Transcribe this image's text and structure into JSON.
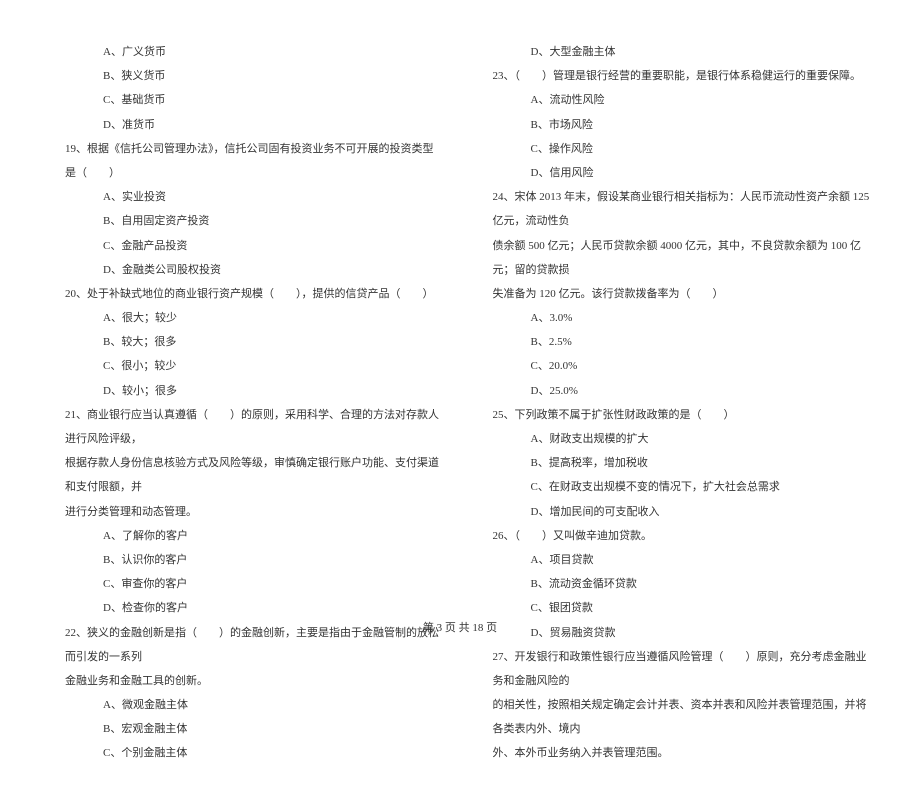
{
  "left": {
    "opts_pre": [
      "A、广义货币",
      "B、狭义货币",
      "C、基础货币",
      "D、准货币"
    ],
    "q19": "19、根据《信托公司管理办法》，信托公司固有投资业务不可开展的投资类型是（　　）",
    "q19_opts": [
      "A、实业投资",
      "B、自用固定资产投资",
      "C、金融产品投资",
      "D、金融类公司股权投资"
    ],
    "q20": "20、处于补缺式地位的商业银行资产规模（　　），提供的信贷产品（　　）",
    "q20_opts": [
      "A、很大；较少",
      "B、较大；很多",
      "C、很小；较少",
      "D、较小；很多"
    ],
    "q21_l1": "21、商业银行应当认真遵循（　　）的原则，采用科学、合理的方法对存款人进行风险评级，",
    "q21_l2": "根据存款人身份信息核验方式及风险等级，审慎确定银行账户功能、支付渠道和支付限额，并",
    "q21_l3": "进行分类管理和动态管理。",
    "q21_opts": [
      "A、了解你的客户",
      "B、认识你的客户",
      "C、审查你的客户",
      "D、检查你的客户"
    ],
    "q22_l1": "22、狭义的金融创新是指（　　）的金融创新，主要是指由于金融管制的放松而引发的一系列",
    "q22_l2": "金融业务和金融工具的创新。",
    "q22_opts": [
      "A、微观金融主体",
      "B、宏观金融主体",
      "C、个别金融主体"
    ]
  },
  "right": {
    "q22_opt_d": "D、大型金融主体",
    "q23": "23、（　　）管理是银行经营的重要职能，是银行体系稳健运行的重要保障。",
    "q23_opts": [
      "A、流动性风险",
      "B、市场风险",
      "C、操作风险",
      "D、信用风险"
    ],
    "q24_l1": "24、宋体 2013 年末，假设某商业银行相关指标为：人民币流动性资产余额 125 亿元，流动性负",
    "q24_l2": "债余额 500 亿元；人民币贷款余额 4000 亿元，其中，不良贷款余额为 100 亿元；留的贷款损",
    "q24_l3": "失准备为 120 亿元。该行贷款拨备率为（　　）",
    "q24_opts": [
      "A、3.0%",
      "B、2.5%",
      "C、20.0%",
      "D、25.0%"
    ],
    "q25": "25、下列政策不属于扩张性财政政策的是（　　）",
    "q25_opts": [
      "A、财政支出规模的扩大",
      "B、提高税率，增加税收",
      "C、在财政支出规模不变的情况下，扩大社会总需求",
      "D、增加民间的可支配收入"
    ],
    "q26": "26、（　　）又叫做辛迪加贷款。",
    "q26_opts": [
      "A、项目贷款",
      "B、流动资金循环贷款",
      "C、银团贷款",
      "D、贸易融资贷款"
    ],
    "q27_l1": "27、开发银行和政策性银行应当遵循风险管理（　　）原则，充分考虑金融业务和金融风险的",
    "q27_l2": "的相关性，按照相关规定确定会计并表、资本并表和风险并表管理范围，并将各类表内外、境内",
    "q27_l3": "外、本外币业务纳入并表管理范围。"
  },
  "footer": "第 3 页 共 18 页"
}
